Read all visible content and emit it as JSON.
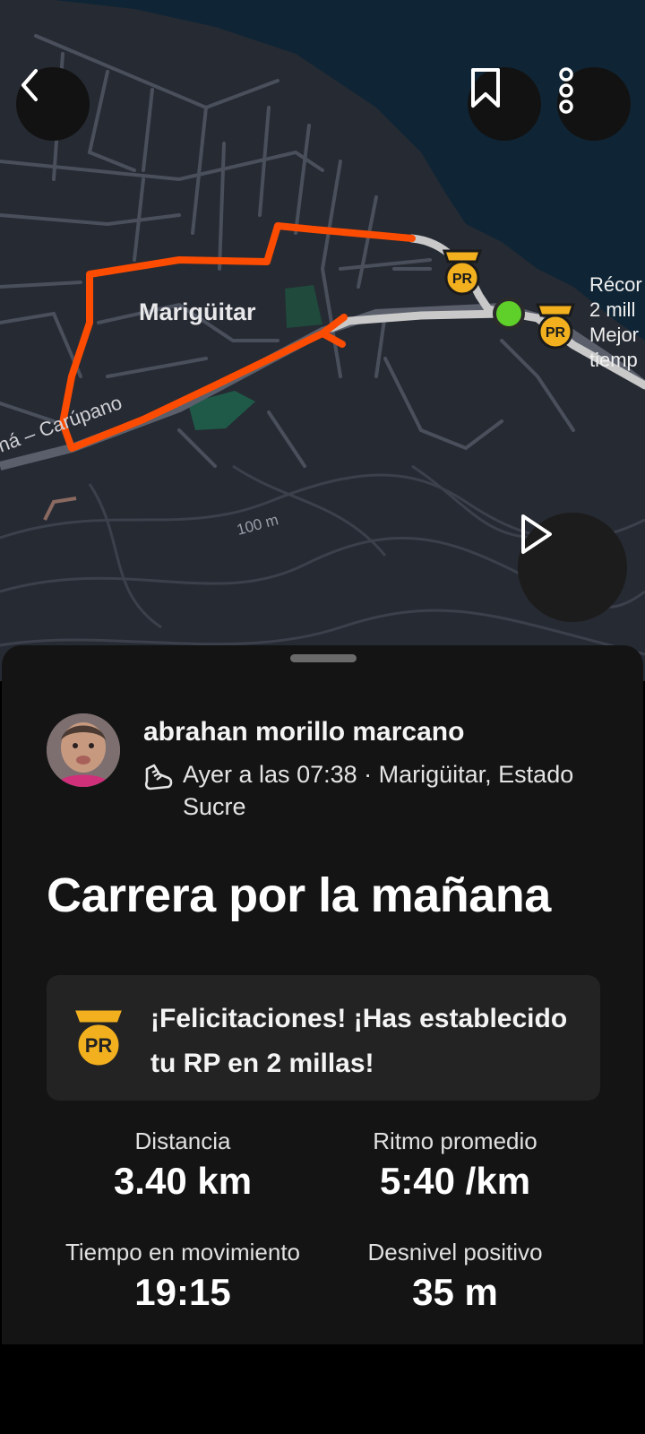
{
  "map": {
    "town_label": "Marigüitar",
    "road_label": "ná – Carúpano",
    "contour_label": "100 m",
    "record_callout_lines": [
      "Récor",
      "2 mill",
      "Mejor",
      "tiemp"
    ],
    "pr_badge_text": "PR",
    "colors": {
      "route": "#fc4c02",
      "start_marker": "#5fcf2a",
      "pr_badge": "#f2b01e",
      "land": "#262a33",
      "water": "#0f2535"
    }
  },
  "toolbar": {
    "back_icon": "chevron-left-icon",
    "bookmark_icon": "bookmark-icon",
    "more_icon": "vertical-dots-icon",
    "play_icon": "play-icon"
  },
  "activity": {
    "athlete_name": "abrahan morillo marcano",
    "activity_type_icon": "running-shoe-icon",
    "meta_text": "Ayer a las 07:38 · Marigüitar, Estado Sucre",
    "title": "Carrera por la mañana",
    "pr_message": "¡Felicitaciones! ¡Has establecido tu RP en 2 millas!",
    "pr_badge_text": "PR"
  },
  "stats": [
    {
      "label": "Distancia",
      "value": "3.40 km"
    },
    {
      "label": "Ritmo promedio",
      "value": "5:40 /km"
    },
    {
      "label": "Tiempo en movimiento",
      "value": "19:15"
    },
    {
      "label": "Desnivel positivo",
      "value": "35 m"
    }
  ]
}
